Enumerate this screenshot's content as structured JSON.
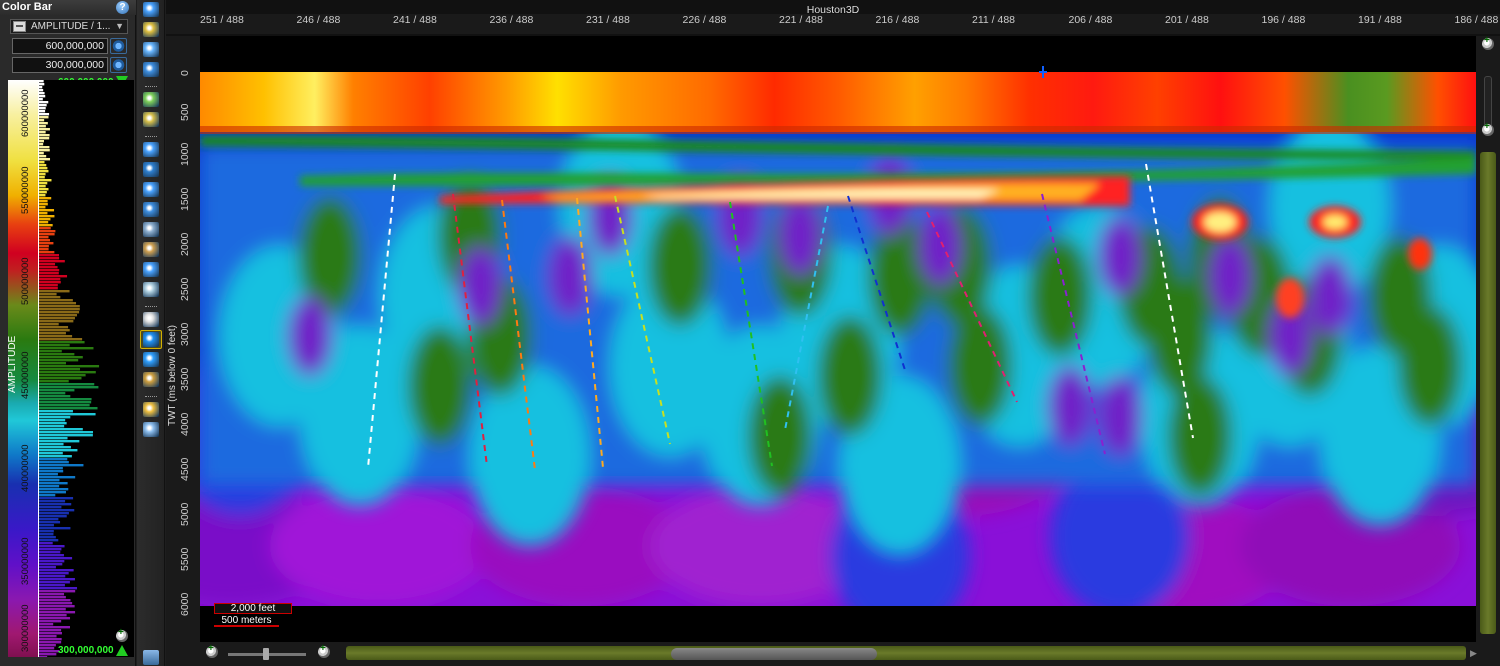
{
  "colorbar": {
    "title": "Color Bar",
    "attribute_label": "AMPLITUDE / 1...",
    "max_value": "600,000,000",
    "min_value": "300,000,000",
    "top_marker": "600,000,000",
    "bottom_marker": "300,000,000",
    "axis_title": "AMPLITUDE",
    "ticks": [
      "600000000",
      "550000000",
      "500000000",
      "450000000",
      "400000000",
      "350000000",
      "300000000"
    ]
  },
  "view": {
    "title": "Houston3D",
    "x_ticks": [
      "251 / 488",
      "246 / 488",
      "241 / 488",
      "236 / 488",
      "231 / 488",
      "226 / 488",
      "221 / 488",
      "216 / 488",
      "211 / 488",
      "206 / 488",
      "201 / 488",
      "196 / 488",
      "191 / 488",
      "186 / 488"
    ],
    "y_axis_title": "TWT (ms below 0 feet)",
    "y_ticks": [
      "0",
      "500",
      "1000",
      "1500",
      "2000",
      "2500",
      "3000",
      "3500",
      "4000",
      "4500",
      "5000",
      "5500",
      "6000"
    ],
    "scale_feet": "2,000 feet",
    "scale_meters": "500 meters"
  },
  "colors": {
    "accent_green": "#22cc22",
    "marker_blue": "#1060ff"
  }
}
